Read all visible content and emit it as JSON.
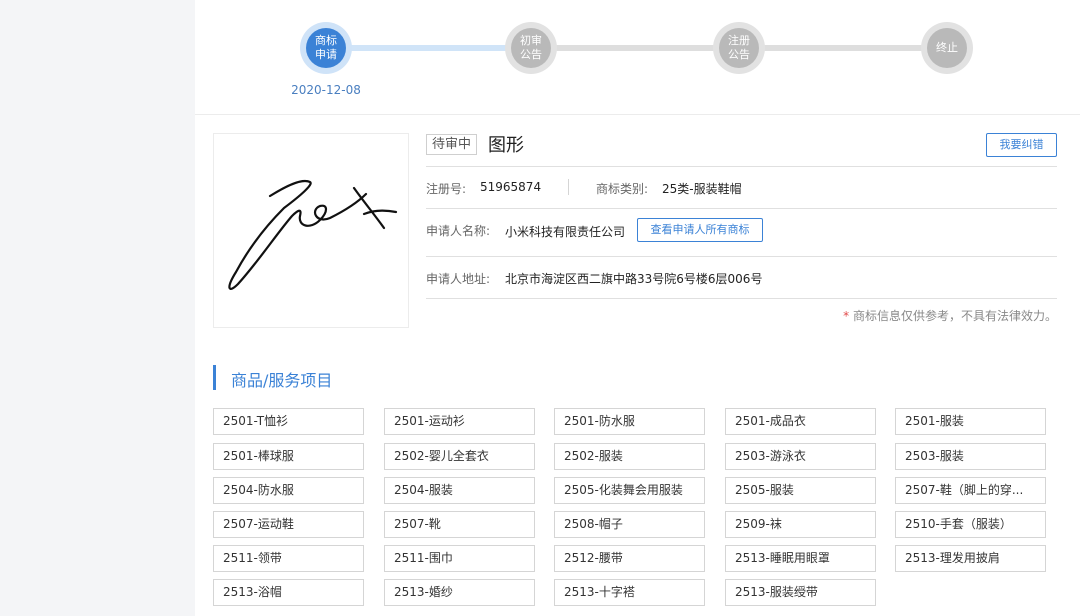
{
  "progress": {
    "steps": [
      {
        "line1": "商标",
        "line2": "申请",
        "state": "active"
      },
      {
        "line1": "初审",
        "line2": "公告",
        "state": "inactive"
      },
      {
        "line1": "注册",
        "line2": "公告",
        "state": "inactive"
      },
      {
        "line1": "终止",
        "line2": "",
        "state": "inactive"
      }
    ],
    "date": "2020-12-08"
  },
  "trademark": {
    "status": "待审中",
    "name": "图形",
    "correct_button": "我要纠错",
    "reg_no_label": "注册号:",
    "reg_no": "51965874",
    "class_label": "商标类别:",
    "class_value": "25类-服装鞋帽",
    "applicant_label": "申请人名称:",
    "applicant": "小米科技有限责任公司",
    "view_all_button": "查看申请人所有商标",
    "address_label": "申请人地址:",
    "address": "北京市海淀区西二旗中路33号院6号楼6层006号",
    "disclaimer_star": "*",
    "disclaimer": " 商标信息仅供参考，不具有法律效力。"
  },
  "goods_section": {
    "title": "商品/服务项目",
    "items": [
      "2501-T恤衫",
      "2501-运动衫",
      "2501-防水服",
      "2501-成品衣",
      "2501-服装",
      "2501-棒球服",
      "2502-婴儿全套衣",
      "2502-服装",
      "2503-游泳衣",
      "2503-服装",
      "2504-防水服",
      "2504-服装",
      "2505-化装舞会用服装",
      "2505-服装",
      "2507-鞋（脚上的穿...",
      "2507-运动鞋",
      "2507-靴",
      "2508-帽子",
      "2509-袜",
      "2510-手套（服装）",
      "2511-领带",
      "2511-围巾",
      "2512-腰带",
      "2513-睡眠用眼罩",
      "2513-理发用披肩",
      "2513-浴帽",
      "2513-婚纱",
      "2513-十字褡",
      "2513-服装绶带"
    ]
  },
  "colors": {
    "accent": "#3b82d6",
    "active_step": "#3b82d6",
    "inactive_step": "#b9b9b9"
  },
  "logo": {
    "icon": "signature-logo-icon"
  }
}
